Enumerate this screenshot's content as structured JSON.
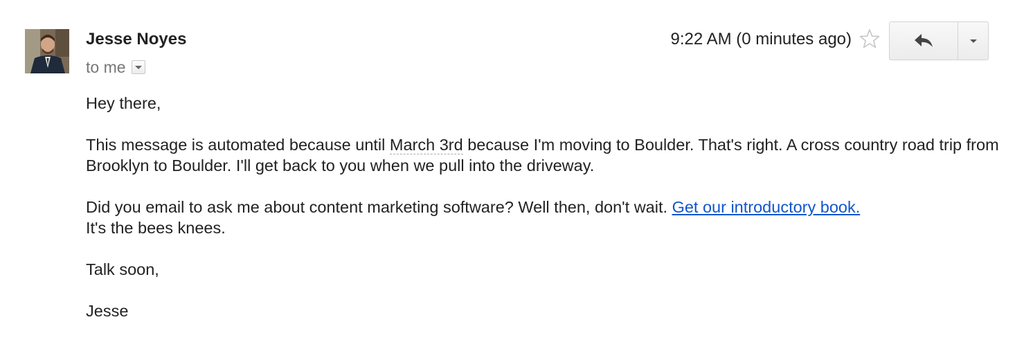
{
  "sender": {
    "name": "Jesse Noyes",
    "recipient_label": "to me"
  },
  "header": {
    "timestamp": "9:22 AM (0 minutes ago)",
    "star_icon": "star-outline-icon",
    "reply_icon": "reply-arrow-icon",
    "more_icon": "chevron-down-icon"
  },
  "message": {
    "greeting": "Hey there,",
    "p1_before": "This message is automated because until ",
    "p1_date": "March 3rd",
    "p1_after": " because I'm moving to Boulder. That's right. A cross country road trip from Brooklyn to Boulder. I'll get back to you when we pull into the driveway.",
    "p2_before": "Did you email to ask me about content marketing software? Well then, don't wait. ",
    "p2_link": "Get our introductory book.",
    "p2_after": "It's the bees knees.",
    "closing": "Talk soon,",
    "signature": "Jesse"
  },
  "colors": {
    "link": "#1155cc",
    "muted_text": "#777777",
    "body_text": "#222222"
  }
}
